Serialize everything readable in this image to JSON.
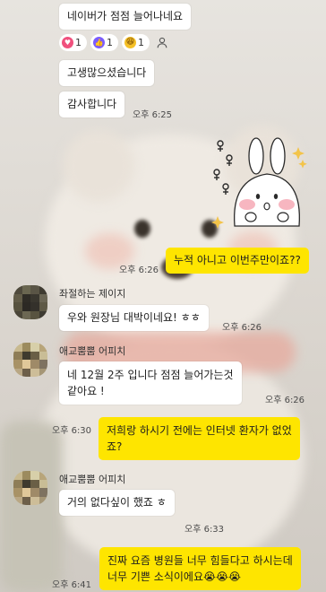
{
  "messages": {
    "m1": "네이버가 점점 늘어나네요",
    "m2": "고생많으셨습니다",
    "m3": "감사합니다",
    "m3_time": "오후 6:25",
    "m4": "누적 아니고 이번주만이죠??",
    "m4_time": "오후 6:26",
    "m5_sender": "좌절하는 제이지",
    "m5": "우와 원장님 대박이네요! ㅎㅎ",
    "m5_time": "오후 6:26",
    "m6_sender": "애교뿜뿜 어피치",
    "m6_line1": "네 12월 2주 입니다 점점 늘어가는것",
    "m6_line2": "같아요 !",
    "m6_time": "오후 6:26",
    "m7_line1": "저희랑 하시기 전에는 인터넷 환자가 없었",
    "m7_line2": "죠?",
    "m7_time": "오후 6:30",
    "m8_sender": "애교뿜뿜 어피치",
    "m8": "거의 없다싶이 했죠 ㅎ",
    "m8_time": "오후 6:33",
    "m9_line1": "진짜 요즘 병원들 너무 힘들다고 하시는데",
    "m9_line2": "너무 기쁜 소식이에요😭😭😭",
    "m9_time": "오후 6:41"
  },
  "reactions": [
    {
      "icon": "heart-icon",
      "count": "1",
      "color": "#f0507d"
    },
    {
      "icon": "thumbs-up-icon",
      "count": "1",
      "color": "#7a5cff"
    },
    {
      "icon": "laugh-emoji-icon",
      "count": "1",
      "color": "#f5c026"
    }
  ],
  "colors": {
    "outgoing_bubble": "#fee500",
    "incoming_bubble": "#ffffff"
  }
}
